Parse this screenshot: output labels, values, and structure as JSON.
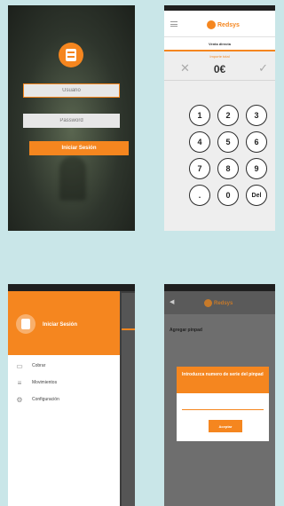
{
  "login": {
    "user_placeholder": "Usuario",
    "password_placeholder": "Password",
    "login_button": "Iniciar Sesión"
  },
  "keypad": {
    "brand": "Redsys",
    "tab": "Venta directa",
    "amount_label": "Importe total",
    "amount": "0€",
    "clear_icon": "✕",
    "confirm_icon": "✓",
    "keys": [
      "1",
      "2",
      "3",
      "4",
      "5",
      "6",
      "7",
      "8",
      "9",
      ".",
      "0",
      "Del"
    ]
  },
  "drawer": {
    "title": "Iniciar Sesión",
    "items": [
      {
        "label": "Cobrar",
        "icon": "card-icon",
        "glyph": "▭"
      },
      {
        "label": "Movimientos",
        "icon": "list-icon",
        "glyph": "≡"
      },
      {
        "label": "Configuración",
        "icon": "gear-icon",
        "glyph": "⚙"
      }
    ]
  },
  "dialog_screen": {
    "brand": "Redsys",
    "back_icon": "◀",
    "subtitle": "Agregar pinpad",
    "dialog_title": "Introduzca numero de serie del pinpad",
    "accept_button": "Aceptar"
  },
  "colors": {
    "accent": "#f5861f"
  }
}
